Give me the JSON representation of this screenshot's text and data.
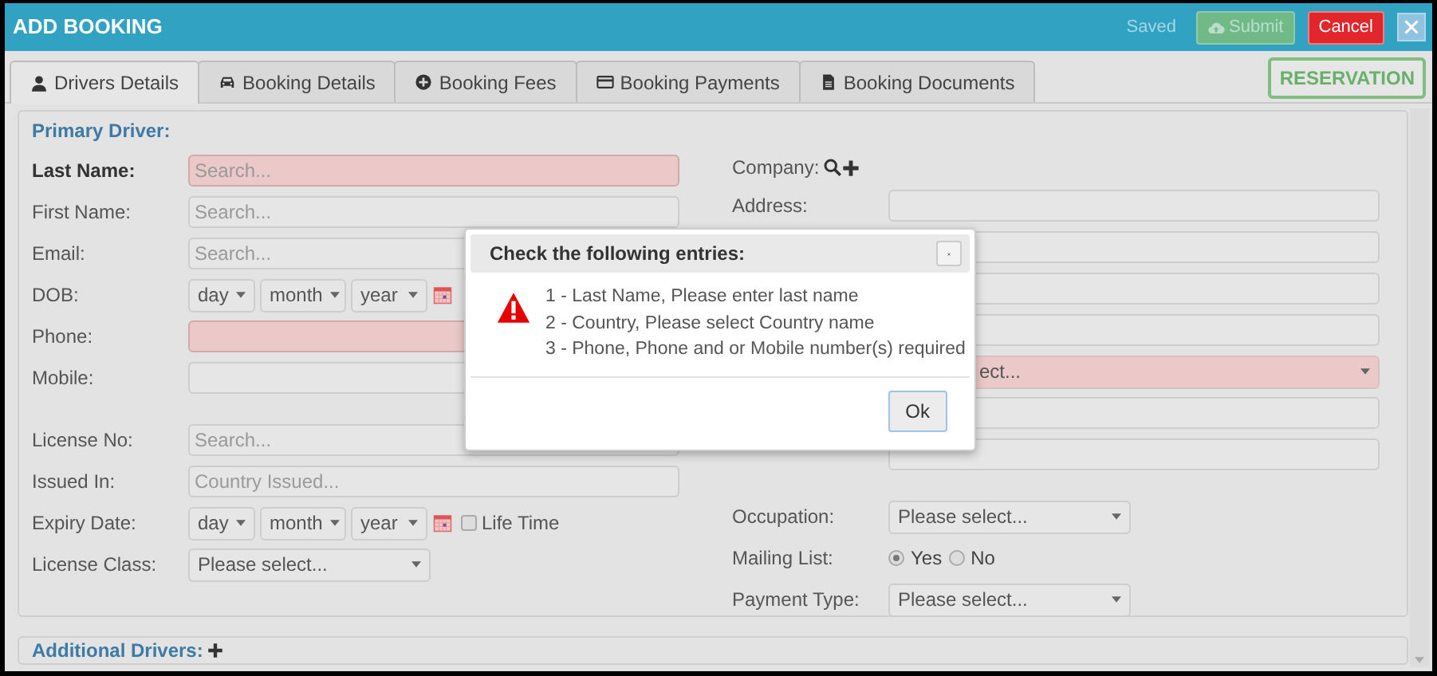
{
  "header": {
    "title": "ADD BOOKING",
    "status": "Saved",
    "buttons": [
      {
        "label": "Submit",
        "kind": "submit",
        "disabled": true
      },
      {
        "label": "Cancel",
        "kind": "cancel",
        "disabled": false
      }
    ]
  },
  "tabs": [
    {
      "label": "Drivers Details",
      "selected": true
    },
    {
      "label": "Booking Details",
      "selected": false
    },
    {
      "label": "Booking Fees",
      "selected": false
    },
    {
      "label": "Booking Payments",
      "selected": false
    },
    {
      "label": "Booking Documents",
      "selected": false
    }
  ],
  "status_badge": "RESERVATION",
  "primary_driver": {
    "legend": "Primary Driver:",
    "left_groups": [
      [
        {
          "label": "Last Name:",
          "kind": "text",
          "placeholder": "Search...",
          "invalid": true,
          "emphasized": true
        },
        {
          "label": "First Name:",
          "kind": "text",
          "placeholder": "Search...",
          "invalid": false
        },
        {
          "label": "Email:",
          "kind": "text",
          "placeholder": "Search...",
          "invalid": false
        },
        {
          "label": "DOB:",
          "kind": "date",
          "parts": [
            "day",
            "month",
            "year"
          ]
        },
        {
          "label": "Phone:",
          "kind": "text",
          "invalid": true
        },
        {
          "label": "Mobile:",
          "kind": "text",
          "invalid": false
        }
      ],
      [
        {
          "label": "License No:",
          "kind": "text",
          "placeholder": "Search...",
          "invalid": false
        },
        {
          "label": "Issued In:",
          "kind": "text",
          "placeholder": "Country Issued...",
          "invalid": false
        },
        {
          "label": "Expiry Date:",
          "kind": "date",
          "parts": [
            "day",
            "month",
            "year"
          ],
          "checkbox": {
            "label": "Life Time",
            "checked": false
          }
        },
        {
          "label": "License Class:",
          "kind": "select",
          "value": "Please select...",
          "invalid": false
        }
      ]
    ],
    "right_groups": [
      [
        {
          "label": "Company:",
          "kind": "lookup"
        },
        {
          "label": "Address:",
          "kind": "text",
          "invalid": false
        },
        {
          "kind": "text",
          "invalid": false
        },
        {
          "kind": "text",
          "invalid": false
        },
        {
          "kind": "text",
          "invalid": false
        },
        {
          "kind": "select",
          "value": "ect...",
          "invalid": true,
          "full_width": true
        },
        {
          "kind": "text",
          "invalid": false
        },
        {
          "kind": "text",
          "invalid": false
        }
      ],
      [
        {
          "label": "Occupation:",
          "kind": "select",
          "value": "Please select...",
          "invalid": false
        },
        {
          "label": "Mailing List:",
          "kind": "radio",
          "options": [
            {
              "label": "Yes",
              "selected": true
            },
            {
              "label": "No",
              "selected": false
            }
          ]
        },
        {
          "label": "Payment Type:",
          "kind": "select",
          "value": "Please select...",
          "invalid": false
        }
      ]
    ]
  },
  "additional_drivers": {
    "legend": "Additional Drivers:"
  },
  "modal": {
    "title": "Check the following entries:",
    "messages": [
      "1 - Last Name, Please enter last name",
      "2 - Country, Please select Country name",
      "3 - Phone, Phone and or Mobile number(s) required"
    ],
    "button": "Ok"
  }
}
